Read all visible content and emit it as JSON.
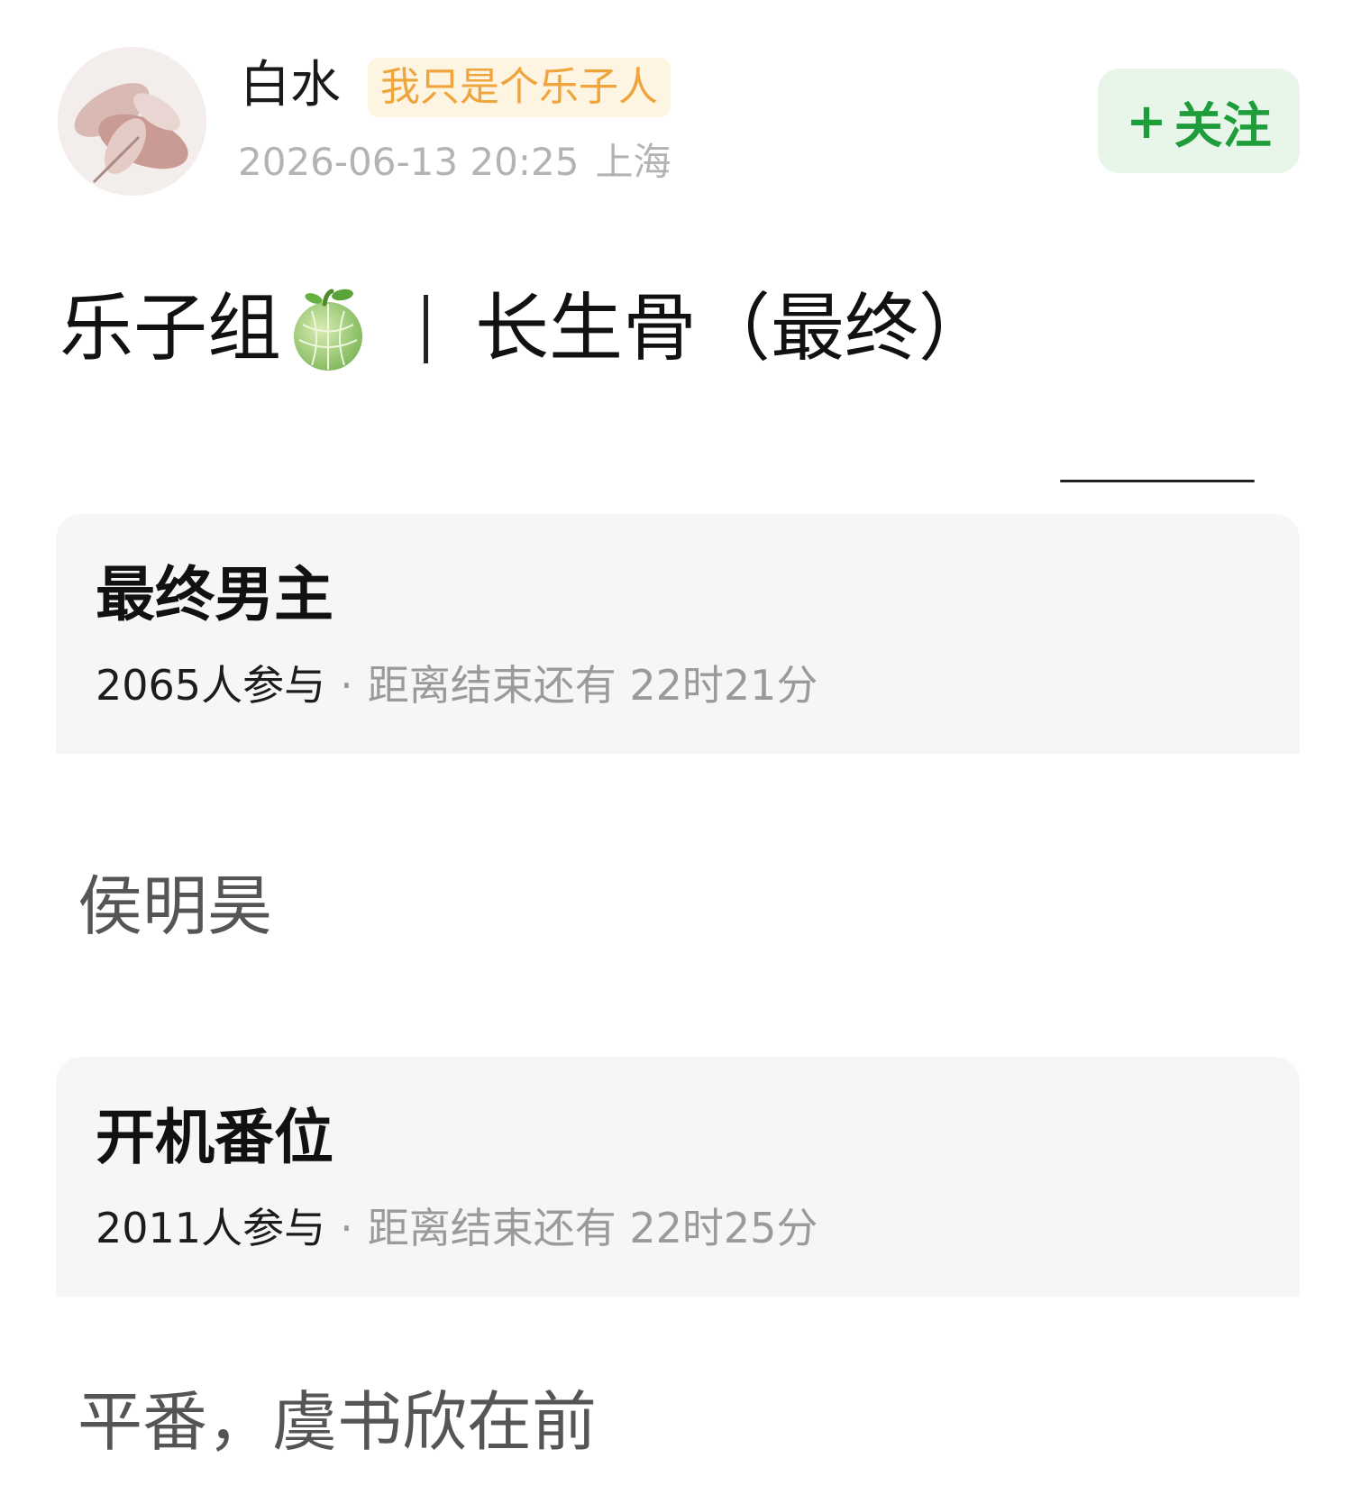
{
  "header": {
    "username": "白水",
    "user_tag": "我只是个乐子人",
    "timestamp": "2026-06-13 20:25",
    "location": "上海",
    "follow_plus": "+",
    "follow_label": "关注"
  },
  "post": {
    "title_prefix": "乐子组",
    "title_emoji": "melon-icon",
    "title_main": "长生骨（最终）"
  },
  "polls": [
    {
      "title": "最终男主",
      "participants": "2065人参与",
      "separator": "·",
      "remaining": "距离结束还有 22时21分",
      "answer": "侯明昊"
    },
    {
      "title": "开机番位",
      "participants": "2011人参与",
      "separator": "·",
      "remaining": "距离结束还有 22时25分",
      "answer": "平番，虞书欣在前"
    }
  ],
  "colors": {
    "follow_text": "#1f9d3a",
    "follow_bg": "#e8f6ea",
    "tag_text": "#f0a43c",
    "tag_bg": "#fdf4e2",
    "card_bg": "#f6f6f6",
    "meta_gray": "#b3b3b3"
  }
}
